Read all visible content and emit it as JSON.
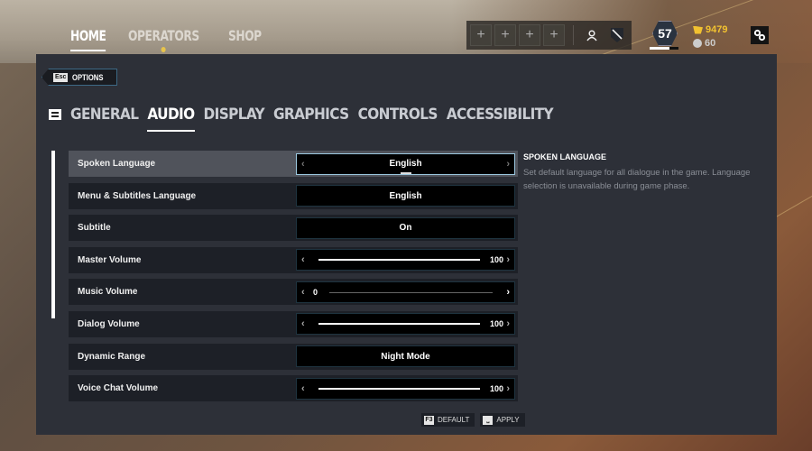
{
  "topnav": {
    "items": [
      {
        "label": "HOME",
        "active": true
      },
      {
        "label": "OPERATORS",
        "active": false,
        "notification": true
      },
      {
        "label": "SHOP",
        "active": false
      }
    ]
  },
  "squad": {
    "slots": [
      "+",
      "+",
      "+",
      "+"
    ],
    "icons": [
      "person-icon",
      "shield-badge-icon"
    ]
  },
  "player": {
    "level": "57",
    "level_progress": 0.7,
    "r6_credits": "9479",
    "renown": "60"
  },
  "header": {
    "back_key": "Esc",
    "back_label": "OPTIONS"
  },
  "tabs": [
    {
      "label": "GENERAL",
      "active": false
    },
    {
      "label": "AUDIO",
      "active": true
    },
    {
      "label": "DISPLAY",
      "active": false
    },
    {
      "label": "GRAPHICS",
      "active": false
    },
    {
      "label": "CONTROLS",
      "active": false
    },
    {
      "label": "ACCESSIBILITY",
      "active": false
    }
  ],
  "settings": [
    {
      "label": "Spoken Language",
      "type": "select",
      "value": "English",
      "selected": true
    },
    {
      "label": "Menu & Subtitles Language",
      "type": "select",
      "value": "English"
    },
    {
      "label": "Subtitle",
      "type": "select",
      "value": "On"
    },
    {
      "label": "Master Volume",
      "type": "slider",
      "value": 100,
      "display": "100"
    },
    {
      "label": "Music Volume",
      "type": "slider",
      "value": 0,
      "display": "0"
    },
    {
      "label": "Dialog Volume",
      "type": "slider",
      "value": 100,
      "display": "100"
    },
    {
      "label": "Dynamic Range",
      "type": "select",
      "value": "Night Mode"
    },
    {
      "label": "Voice Chat Volume",
      "type": "slider",
      "value": 100,
      "display": "100"
    }
  ],
  "description": {
    "title": "SPOKEN LANGUAGE",
    "text": "Set default language for all dialogue in the game. Language selection is unavailable during game phase."
  },
  "footer": {
    "default_key": "F3",
    "default_label": "DEFAULT",
    "apply_key": "Space",
    "apply_label": "APPLY"
  },
  "colors": {
    "panel_bg": "#2d3038",
    "accent_gold": "#f2c230",
    "selected_border": "#9cc8e0"
  }
}
